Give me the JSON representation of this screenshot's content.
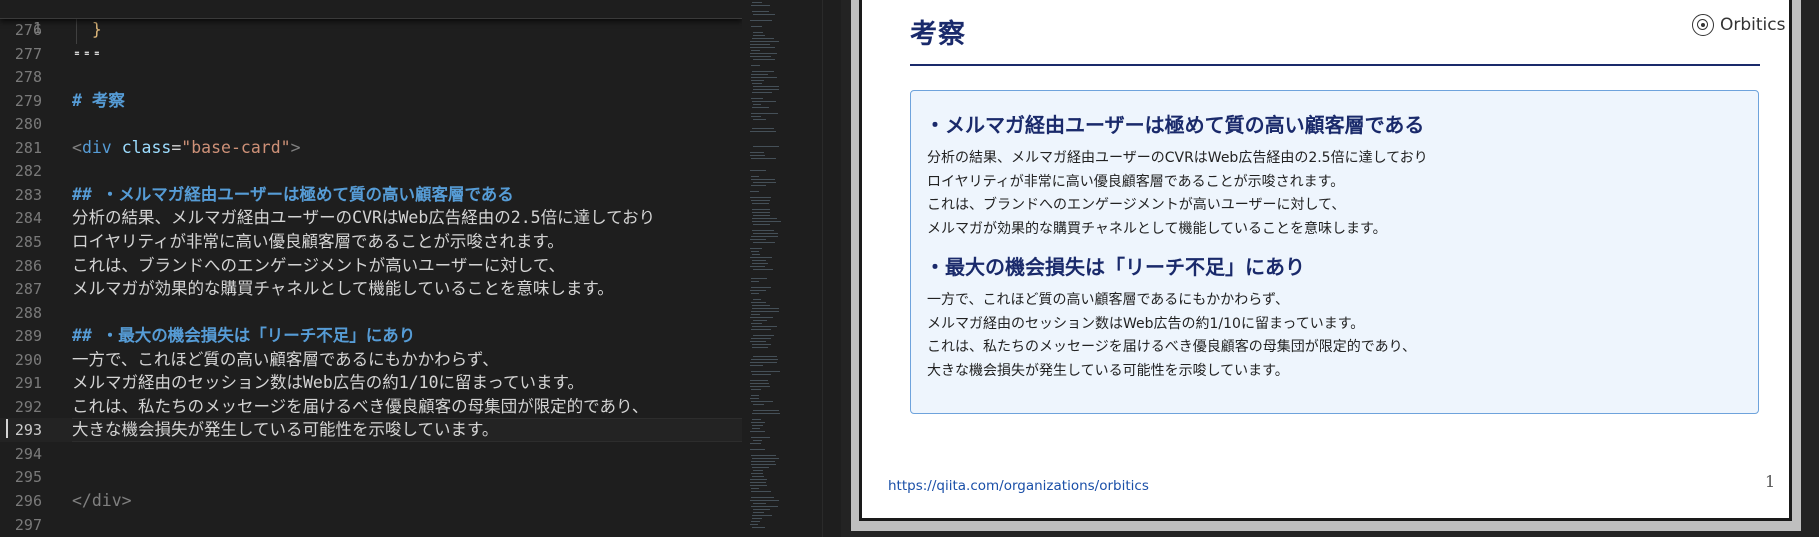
{
  "editor": {
    "sticky": {
      "ln": "1",
      "text": "---"
    },
    "lines": [
      {
        "ln": "276",
        "text": "  }",
        "kind": "brace"
      },
      {
        "ln": "277",
        "text": "---",
        "kind": "text"
      },
      {
        "ln": "278",
        "text": "",
        "kind": "text"
      },
      {
        "ln": "279",
        "text": "# 考察",
        "kind": "head"
      },
      {
        "ln": "280",
        "text": "",
        "kind": "text"
      },
      {
        "ln": "281",
        "text": "<div class=\"base-card\">",
        "kind": "tag"
      },
      {
        "ln": "282",
        "text": "",
        "kind": "text"
      },
      {
        "ln": "283",
        "text": "## ・メルマガ経由ユーザーは極めて質の高い顧客層である",
        "kind": "head"
      },
      {
        "ln": "284",
        "text": "分析の結果、メルマガ経由ユーザーのCVRはWeb広告経由の2.5倍に達しており",
        "kind": "text"
      },
      {
        "ln": "285",
        "text": "ロイヤリティが非常に高い優良顧客層であることが示唆されます。",
        "kind": "text"
      },
      {
        "ln": "286",
        "text": "これは、ブランドへのエンゲージメントが高いユーザーに対して、",
        "kind": "text"
      },
      {
        "ln": "287",
        "text": "メルマガが効果的な購買チャネルとして機能していることを意味します。",
        "kind": "text"
      },
      {
        "ln": "288",
        "text": "",
        "kind": "text"
      },
      {
        "ln": "289",
        "text": "## ・最大の機会損失は「リーチ不足」にあり",
        "kind": "head"
      },
      {
        "ln": "290",
        "text": "一方で、これほど質の高い顧客層であるにもかかわらず、",
        "kind": "text"
      },
      {
        "ln": "291",
        "text": "メルマガ経由のセッション数はWeb広告の約1/10に留まっています。",
        "kind": "text"
      },
      {
        "ln": "292",
        "text": "これは、私たちのメッセージを届けるべき優良顧客の母集団が限定的であり、",
        "kind": "text"
      },
      {
        "ln": "293",
        "text": "大きな機会損失が発生している可能性を示唆しています。",
        "kind": "text",
        "current": true
      },
      {
        "ln": "294",
        "text": "",
        "kind": "text"
      },
      {
        "ln": "295",
        "text": "",
        "kind": "text"
      },
      {
        "ln": "296",
        "text": "</div>",
        "kind": "tagclose"
      },
      {
        "ln": "297",
        "text": "",
        "kind": "text"
      }
    ],
    "tag_parts": {
      "open": "<",
      "name": "div",
      "attr": "class",
      "eq": "=",
      "value": "\"base-card\"",
      "close": ">"
    },
    "colors": {
      "background": "#1e1e1e",
      "heading": "#569cd6",
      "text": "#d4d4d4",
      "string": "#ce9178"
    }
  },
  "preview": {
    "title": "考察",
    "logo_text": "Orbitics",
    "sections": [
      {
        "heading": "・メルマガ経由ユーザーは極めて質の高い顧客層である",
        "lines": [
          "分析の結果、メルマガ経由ユーザーのCVRはWeb広告経由の2.5倍に達しており",
          "ロイヤリティが非常に高い優良顧客層であることが示唆されます。",
          "これは、ブランドへのエンゲージメントが高いユーザーに対して、",
          "メルマガが効果的な購買チャネルとして機能していることを意味します。"
        ]
      },
      {
        "heading": "・最大の機会損失は「リーチ不足」にあり",
        "lines": [
          "一方で、これほど質の高い顧客層であるにもかかわらず、",
          "メルマガ経由のセッション数はWeb広告の約1/10に留まっています。",
          "これは、私たちのメッセージを届けるべき優良顧客の母集団が限定的であり、",
          "大きな機会損失が発生している可能性を示唆しています。"
        ]
      }
    ],
    "footer_link": "https://qiita.com/organizations/orbitics",
    "page_number": "1",
    "colors": {
      "title": "#1a2a6b",
      "card_bg": "#eef5fd",
      "card_border": "#6ea3dc",
      "link": "#1a4fa8"
    }
  }
}
